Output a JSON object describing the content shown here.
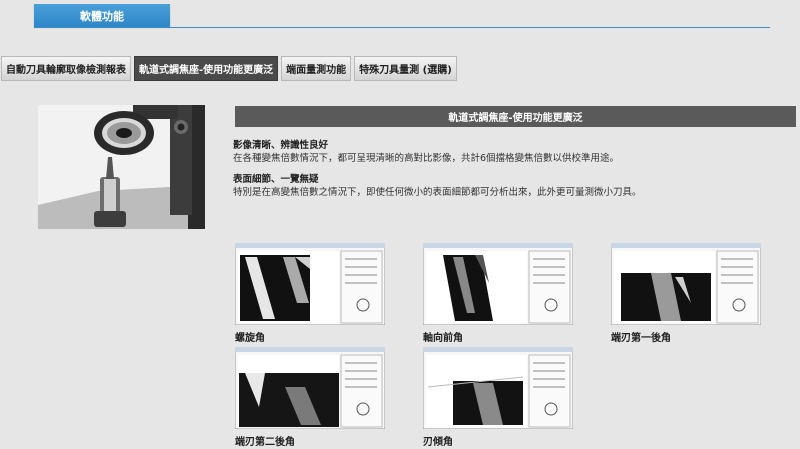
{
  "section": {
    "title": "軟體功能"
  },
  "tabs": [
    {
      "label": "自動刀具輪廓取像檢測報表",
      "active": false
    },
    {
      "label": "軌道式調焦座-使用功能更廣泛",
      "active": true
    },
    {
      "label": "端面量測功能",
      "active": false
    },
    {
      "label": "特殊刀具量測 (選購)",
      "active": false
    }
  ],
  "content": {
    "title": "軌道式調焦座-使用功能更廣泛",
    "features": [
      {
        "heading": "影像清晰、辨識性良好",
        "text": "在各種變焦倍數情況下，都可呈現清晰的高對比影像，共計6個擋格變焦倍數以供校準用途。"
      },
      {
        "heading": "表面細節、一覽無疑",
        "text": "特別是在高變焦倍數之情況下，即使任何微小的表面細節都可分析出來，此外更可量測微小刀具。"
      }
    ]
  },
  "thumbnails": [
    {
      "label": "螺旋角"
    },
    {
      "label": "軸向前角"
    },
    {
      "label": "端刃第一後角"
    },
    {
      "label": "端刃第二後角"
    },
    {
      "label": "刃傾角"
    }
  ],
  "colors": {
    "accent": "#2e86c8",
    "tab_active": "#4a4a4a",
    "bar": "#5a5a5a"
  }
}
